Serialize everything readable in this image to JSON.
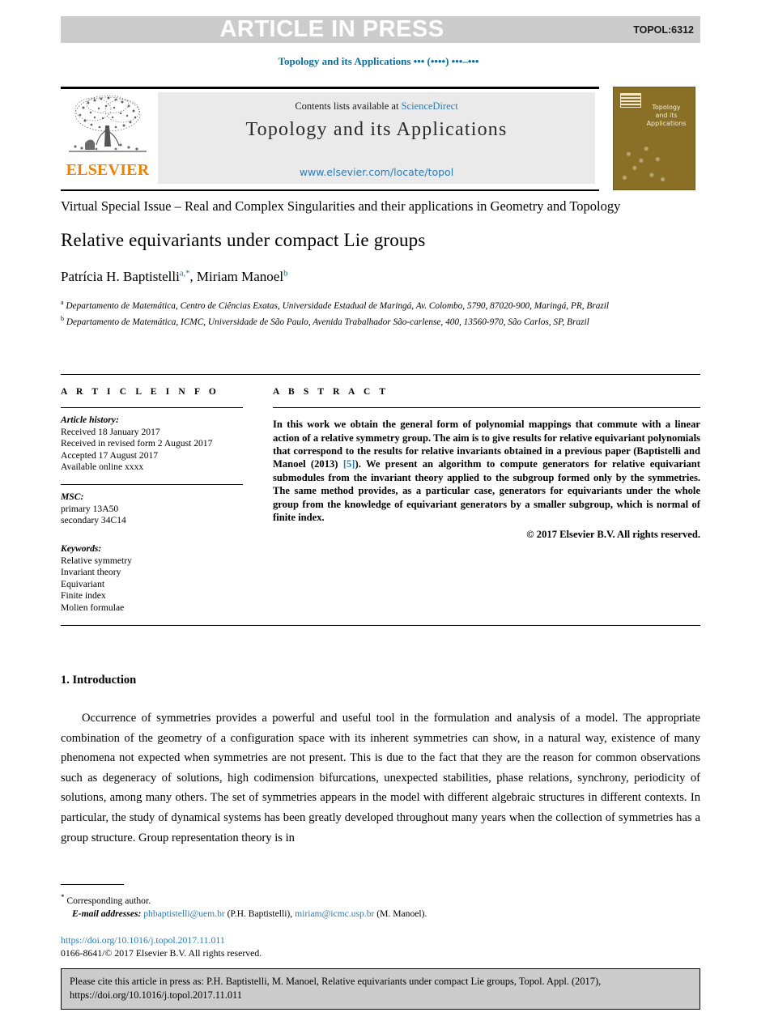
{
  "banner": {
    "title": "ARTICLE IN PRESS",
    "code": "TOPOL:6312",
    "bg_color": "#cccccc",
    "text_color": "#ffffff"
  },
  "running_head": "Topology and its Applications ••• (••••) •••–•••",
  "masthead": {
    "contents_prefix": "Contents lists available at",
    "sciencedirect": "ScienceDirect",
    "journal_title": "Topology and its Applications",
    "journal_url": "www.elsevier.com/locate/topol",
    "publisher_wordmark": "ELSEVIER",
    "publisher_color": "#ef8200",
    "link_color": "#2b7bba",
    "cover": {
      "title_line1": "Topology",
      "title_line2": "and its",
      "title_line3": "Applications",
      "bg_color": "#8a7027"
    }
  },
  "article": {
    "special_issue": "Virtual Special Issue – Real and Complex Singularities and their applications in Geometry and Topology",
    "title": "Relative equivariants under compact Lie groups",
    "authors": [
      {
        "name": "Patrícia H. Baptistelli",
        "marks": "a,*"
      },
      {
        "name": "Miriam Manoel",
        "marks": "b"
      }
    ],
    "affiliations": [
      {
        "mark": "a",
        "text": "Departamento de Matemática, Centro de Ciências Exatas, Universidade Estadual de Maringá, Av. Colombo, 5790, 87020-900, Maringá, PR, Brazil"
      },
      {
        "mark": "b",
        "text": "Departamento de Matemática, ICMC, Universidade de São Paulo, Avenida Trabalhador São-carlense, 400, 13560-970, São Carlos, SP, Brazil"
      }
    ]
  },
  "info": {
    "heading": "A R T I C L E   I N F O",
    "history_label": "Article history:",
    "history": [
      "Received 18 January 2017",
      "Received in revised form 2 August 2017",
      "Accepted 17 August 2017",
      "Available online xxxx"
    ],
    "msc_label": "MSC:",
    "msc": [
      "primary 13A50",
      "secondary 34C14"
    ],
    "keywords_label": "Keywords:",
    "keywords": [
      "Relative symmetry",
      "Invariant theory",
      "Equivariant",
      "Finite index",
      "Molien formulae"
    ]
  },
  "abstract": {
    "heading": "A B S T R A C T",
    "part1": "In this work we obtain the general form of polynomial mappings that commute with a linear action of a relative symmetry group. The aim is to give results for relative equivariant polynomials that correspond to the results for relative invariants obtained in a previous paper (Baptistelli and Manoel (2013) ",
    "ref": "[5]",
    "part2": "). We present an algorithm to compute generators for relative equivariant submodules from the invariant theory applied to the subgroup formed only by the symmetries. The same method provides, as a particular case, generators for equivariants under the whole group from the knowledge of equivariant generators by a smaller subgroup, which is normal of finite index.",
    "copyright": "© 2017 Elsevier B.V. All rights reserved."
  },
  "body": {
    "section_heading": "1. Introduction",
    "paragraph": "Occurrence of symmetries provides a powerful and useful tool in the formulation and analysis of a model. The appropriate combination of the geometry of a configuration space with its inherent symmetries can show, in a natural way, existence of many phenomena not expected when symmetries are not present. This is due to the fact that they are the reason for common observations such as degeneracy of solutions, high codimension bifurcations, unexpected stabilities, phase relations, synchrony, periodicity of solutions, among many others. The set of symmetries appears in the model with different algebraic structures in different contexts. In particular, the study of dynamical systems has been greatly developed throughout many years when the collection of symmetries has a group structure. Group representation theory is in"
  },
  "footnotes": {
    "corresponding": "Corresponding author.",
    "email_label": "E-mail addresses:",
    "email1": "phbaptistelli@uem.br",
    "email1_owner": "(P.H. Baptistelli),",
    "email2": "miriam@icmc.usp.br",
    "email2_owner": "(M. Manoel).",
    "doi": "https://doi.org/10.1016/j.topol.2017.11.011",
    "issn": "0166-8641/© 2017 Elsevier B.V. All rights reserved."
  },
  "cite_box": {
    "text": "Please cite this article in press as: P.H. Baptistelli, M. Manoel, Relative equivariants under compact Lie groups, Topol. Appl. (2017), https://doi.org/10.1016/j.topol.2017.11.011"
  }
}
